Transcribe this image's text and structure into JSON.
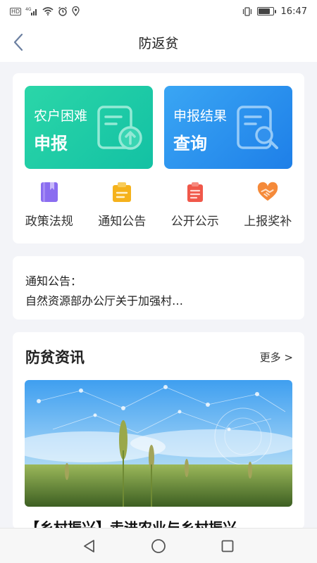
{
  "status_bar": {
    "time": "16:47",
    "hd_label": "HD",
    "network_label": "4G",
    "icons": [
      "hd-icon",
      "signal-icon",
      "wifi-icon",
      "alarm-icon",
      "location-icon",
      "vibrate-icon",
      "battery-icon"
    ]
  },
  "header": {
    "title": "防返贫",
    "back_icon": "chevron-left-icon"
  },
  "actions": {
    "report": {
      "line1": "农户困难",
      "line2": "申报",
      "color": "#1ccaa6",
      "icon": "document-upload-icon"
    },
    "query": {
      "line1": "申报结果",
      "line2": "查询",
      "color": "#2a8ef0",
      "icon": "document-search-icon"
    }
  },
  "shortcuts": [
    {
      "label": "政策法规",
      "icon": "book-icon",
      "color": "#8a6df0"
    },
    {
      "label": "通知公告",
      "icon": "clipboard-icon",
      "color": "#f5b21c"
    },
    {
      "label": "公开公示",
      "icon": "document-list-icon",
      "color": "#f0584a"
    },
    {
      "label": "上报奖补",
      "icon": "handshake-heart-icon",
      "color": "#f58a3a"
    }
  ],
  "notice": {
    "title": "通知公告：",
    "text": "自然资源部办公厅关于加强村…"
  },
  "news": {
    "title": "防贫资讯",
    "more": "更多 >",
    "headline": "【乡村振兴】走进农业与乡村振兴"
  },
  "nav": {
    "back_icon": "triangle-back-icon",
    "home_icon": "circle-home-icon",
    "recent_icon": "square-recent-icon"
  }
}
